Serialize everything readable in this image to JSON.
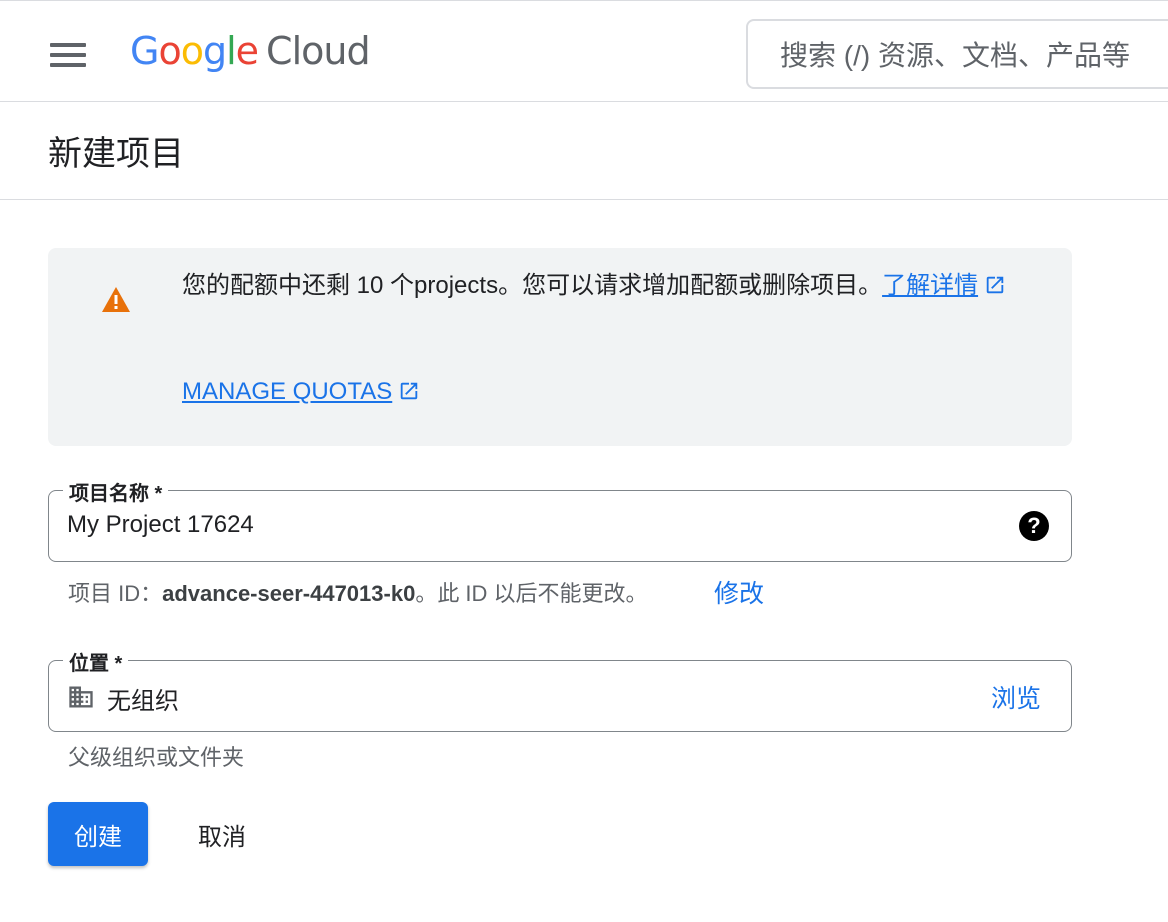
{
  "header": {
    "menu_icon": "hamburger-menu-icon",
    "logo": {
      "letters": [
        "G",
        "o",
        "o",
        "g",
        "l",
        "e"
      ],
      "product": "Cloud",
      "colors": [
        "#4285f4",
        "#ea4335",
        "#fbbc04",
        "#4285f4",
        "#34a853",
        "#ea4335"
      ]
    },
    "search_placeholder": "搜索 (/) 资源、文档、产品等"
  },
  "page": {
    "title": "新建项目"
  },
  "alert": {
    "icon": "warning-icon",
    "message": "您的配额中还剩 10 个projects。您可以请求增加配额或删除项目。",
    "learn_more_link": "了解详情",
    "manage_quotas_link": "MANAGE QUOTAS"
  },
  "project_name_field": {
    "label": "项目名称 *",
    "value": "My Project 17624",
    "help_icon": "help-icon"
  },
  "project_id": {
    "prefix": "项目 ID：",
    "value": "advance-seer-447013-k0",
    "suffix": "。此 ID 以后不能更改。",
    "edit_link": "修改"
  },
  "location_field": {
    "label": "位置 *",
    "value": "无组织",
    "icon": "organization-building-icon",
    "browse_link": "浏览",
    "hint": "父级组织或文件夹"
  },
  "actions": {
    "create": "创建",
    "cancel": "取消"
  },
  "colors": {
    "accent": "#1a73e8",
    "warning": "#e8710a",
    "alert_background": "#f1f3f4"
  }
}
